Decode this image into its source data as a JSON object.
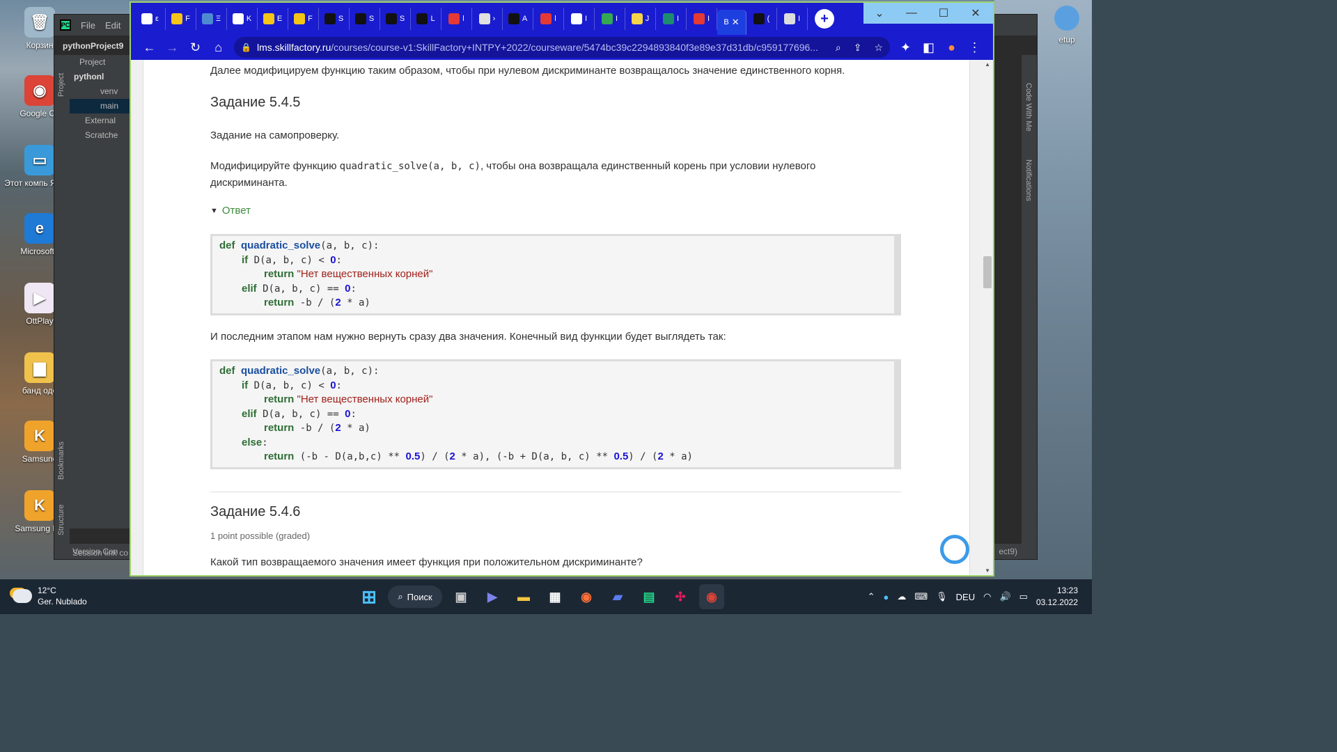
{
  "desktop": {
    "icons": [
      {
        "label": "Корзин",
        "color": "#9fb8c9",
        "glyph": "🗑"
      },
      {
        "label": "Google Ch",
        "color": "#db4437",
        "glyph": "◉"
      },
      {
        "label": "Этот компь Ярлык",
        "color": "#3a9ad9",
        "glyph": "▭"
      },
      {
        "label": "Microsoft I",
        "color": "#1f7ad6",
        "glyph": "e"
      },
      {
        "label": "OttPlay",
        "color": "#efe7f3",
        "glyph": "▶"
      },
      {
        "label": "банд оде",
        "color": "#f0c24b",
        "glyph": "▆"
      },
      {
        "label": "Samsung",
        "color": "#f0a32a",
        "glyph": "K"
      },
      {
        "label": "Samsung Kie",
        "color": "#f0a32a",
        "glyph": "K"
      }
    ],
    "right_icon_label": "etup"
  },
  "pycharm": {
    "menu": [
      "File",
      "Edit"
    ],
    "project_name": "pythonProject9",
    "side_tabs": [
      "Project",
      "Bookmarks",
      "Structure"
    ],
    "right_tabs": [
      "Code With Me",
      "Notifications"
    ],
    "tree": [
      "Project",
      "pythonl",
      "venv",
      "main",
      "External",
      "Scratche"
    ],
    "bottom": [
      "Version Con",
      "Session link co"
    ],
    "status_right": "ect9)"
  },
  "chrome": {
    "tabs": [
      {
        "letter": "ε",
        "color": "#ffffff"
      },
      {
        "letter": "F",
        "color": "#f5c518"
      },
      {
        "letter": "Ξ",
        "color": "#4d8bd1"
      },
      {
        "letter": "K",
        "color": "#ffffff"
      },
      {
        "letter": "E",
        "color": "#f5c518"
      },
      {
        "letter": "F",
        "color": "#f5c518"
      },
      {
        "letter": "S",
        "color": "#111111"
      },
      {
        "letter": "S",
        "color": "#111111"
      },
      {
        "letter": "S",
        "color": "#111111"
      },
      {
        "letter": "L",
        "color": "#111111"
      },
      {
        "letter": "l",
        "color": "#e53935"
      },
      {
        "letter": "›",
        "color": "#e0e0e0"
      },
      {
        "letter": "A",
        "color": "#111111"
      },
      {
        "letter": "l",
        "color": "#e53935"
      },
      {
        "letter": "I",
        "color": "#ffffff"
      },
      {
        "letter": "I",
        "color": "#34a853"
      },
      {
        "letter": "J",
        "color": "#f5d44a"
      },
      {
        "letter": "I",
        "color": "#1e8c6e"
      },
      {
        "letter": "I",
        "color": "#e53935"
      }
    ],
    "active_tab": {
      "letter": "B",
      "close": "✕"
    },
    "after_active_tabs": [
      {
        "letter": "(",
        "color": "#111111"
      },
      {
        "letter": "I",
        "color": "#dddddd"
      }
    ],
    "url_host": "lms.skillfactory.ru",
    "url_path": "/courses/course-v1:SkillFactory+INTPY+2022/courseware/5474bc39c2294893840f3e89e37d31db/c959177696...",
    "accent": "#1a1ccf"
  },
  "page": {
    "intro": "Далее модифицируем функцию таким образом, чтобы при нулевом дискриминанте возвращалось значение единственного корня.",
    "task1_title": "Задание 5.4.5",
    "task1_sub": "Задание на самопроверку.",
    "task1_text_before": "Модифицируйте функцию ",
    "task1_code": "quadratic_solve(a, b, c)",
    "task1_text_after": ", чтобы она возвращала единственный корень при условии нулевого",
    "task1_text_line2": "дискриминанта.",
    "answer_label": "Ответ",
    "code1": {
      "l1_kw": "def",
      "l1_fn": "quadratic_solve",
      "l1_rest": "(a, b, c):",
      "l2_kw": "if",
      "l2_mid": " D(a, b, c) < ",
      "l2_num": "0",
      "l2_end": ":",
      "l3_kw": "return",
      "l3_str": " \"Нет вещественных корней\"",
      "l4_kw": "elif",
      "l4_mid": " D(a, b, c) == ",
      "l4_num": "0",
      "l4_end": ":",
      "l5_kw": "return",
      "l5_a": " -b / (",
      "l5_num": "2",
      "l5_b": " * a)"
    },
    "middle_text": "И последним этапом нам нужно вернуть сразу два значения. Конечный вид функции будет выглядеть так:",
    "code2": {
      "l1_kw": "def",
      "l1_fn": "quadratic_solve",
      "l1_rest": "(a, b, c):",
      "l2_kw": "if",
      "l2_mid": " D(a, b, c) < ",
      "l2_num": "0",
      "l2_end": ":",
      "l3_kw": "return",
      "l3_str": " \"Нет вещественных корней\"",
      "l4_kw": "elif",
      "l4_mid": " D(a, b, c) == ",
      "l4_num": "0",
      "l4_end": ":",
      "l5_kw": "return",
      "l5_a": " -b / (",
      "l5_num": "2",
      "l5_b": " * a)",
      "l6_kw": "else",
      "l6_end": ":",
      "l7_kw": "return",
      "l7_a": " (-b - D(a,b,c) ** ",
      "l7_n1": "0.5",
      "l7_b": ") / (",
      "l7_n2": "2",
      "l7_c": " * a), (-b + D(a, b, c) ** ",
      "l7_n3": "0.5",
      "l7_d": ") / (",
      "l7_n4": "2",
      "l7_e": " * a)"
    },
    "task2_title": "Задание 5.4.6",
    "task2_points": "1 point possible (graded)",
    "task2_question": "Какой тип возвращаемого значения имеет функция при положительном дискриминанте?"
  },
  "taskbar": {
    "weather_temp": "12°C",
    "weather_desc": "Ger. Nublado",
    "search_label": "Поиск",
    "lang": "DEU",
    "time": "13:23",
    "date": "03.12.2022"
  }
}
